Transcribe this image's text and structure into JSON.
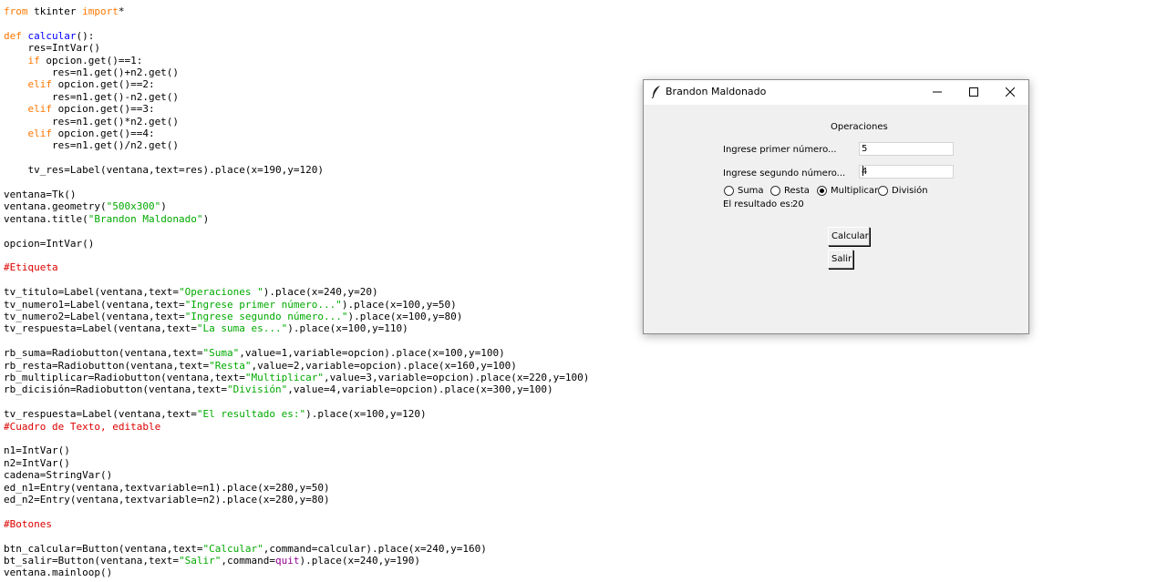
{
  "editor": {
    "lines": [
      [
        {
          "t": "from",
          "c": "kw"
        },
        {
          "t": " tkinter "
        },
        {
          "t": "import",
          "c": "kw"
        },
        {
          "t": "*"
        }
      ],
      [],
      [
        {
          "t": "def",
          "c": "kw"
        },
        {
          "t": " "
        },
        {
          "t": "calcular",
          "c": "def"
        },
        {
          "t": "():"
        }
      ],
      [
        {
          "t": "    res=IntVar()"
        }
      ],
      [
        {
          "t": "    "
        },
        {
          "t": "if",
          "c": "kw"
        },
        {
          "t": " opcion.get()==1:"
        }
      ],
      [
        {
          "t": "        res=n1.get()+n2.get()"
        }
      ],
      [
        {
          "t": "    "
        },
        {
          "t": "elif",
          "c": "kw"
        },
        {
          "t": " opcion.get()==2:"
        }
      ],
      [
        {
          "t": "        res=n1.get()-n2.get()"
        }
      ],
      [
        {
          "t": "    "
        },
        {
          "t": "elif",
          "c": "kw"
        },
        {
          "t": " opcion.get()==3:"
        }
      ],
      [
        {
          "t": "        res=n1.get()*n2.get()"
        }
      ],
      [
        {
          "t": "    "
        },
        {
          "t": "elif",
          "c": "kw"
        },
        {
          "t": " opcion.get()==4:"
        }
      ],
      [
        {
          "t": "        res=n1.get()/n2.get()"
        }
      ],
      [],
      [
        {
          "t": "    tv_res=Label(ventana,text=res).place(x=190,y=120)"
        }
      ],
      [],
      [
        {
          "t": "ventana=Tk()"
        }
      ],
      [
        {
          "t": "ventana.geometry("
        },
        {
          "t": "\"500x300\"",
          "c": "str"
        },
        {
          "t": ")"
        }
      ],
      [
        {
          "t": "ventana.title("
        },
        {
          "t": "\"Brandon Maldonado\"",
          "c": "str"
        },
        {
          "t": ")"
        }
      ],
      [],
      [
        {
          "t": "opcion=IntVar()"
        }
      ],
      [],
      [
        {
          "t": "#Etiqueta",
          "c": "cmt"
        }
      ],
      [],
      [
        {
          "t": "tv_titulo=Label(ventana,text="
        },
        {
          "t": "\"Operaciones \"",
          "c": "str"
        },
        {
          "t": ").place(x=240,y=20)"
        }
      ],
      [
        {
          "t": "tv_numero1=Label(ventana,text="
        },
        {
          "t": "\"Ingrese primer número...\"",
          "c": "str"
        },
        {
          "t": ").place(x=100,y=50)"
        }
      ],
      [
        {
          "t": "tv_numero2=Label(ventana,text="
        },
        {
          "t": "\"Ingrese segundo número...\"",
          "c": "str"
        },
        {
          "t": ").place(x=100,y=80)"
        }
      ],
      [
        {
          "t": "tv_respuesta=Label(ventana,text="
        },
        {
          "t": "\"La suma es...\"",
          "c": "str"
        },
        {
          "t": ").place(x=100,y=110)"
        }
      ],
      [],
      [
        {
          "t": "rb_suma=Radiobutton(ventana,text="
        },
        {
          "t": "\"Suma\"",
          "c": "str"
        },
        {
          "t": ",value=1,variable=opcion).place(x=100,y=100)"
        }
      ],
      [
        {
          "t": "rb_resta=Radiobutton(ventana,text="
        },
        {
          "t": "\"Resta\"",
          "c": "str"
        },
        {
          "t": ",value=2,variable=opcion).place(x=160,y=100)"
        }
      ],
      [
        {
          "t": "rb_multiplicar=Radiobutton(ventana,text="
        },
        {
          "t": "\"Multiplicar\"",
          "c": "str"
        },
        {
          "t": ",value=3,variable=opcion).place(x=220,y=100)"
        }
      ],
      [
        {
          "t": "rb_dicisión=Radiobutton(ventana,text="
        },
        {
          "t": "\"División\"",
          "c": "str"
        },
        {
          "t": ",value=4,variable=opcion).place(x=300,y=100)"
        }
      ],
      [],
      [
        {
          "t": "tv_respuesta=Label(ventana,text="
        },
        {
          "t": "\"El resultado es:\"",
          "c": "str"
        },
        {
          "t": ").place(x=100,y=120)"
        }
      ],
      [
        {
          "t": "#Cuadro de Texto, editable",
          "c": "cmt"
        }
      ],
      [],
      [
        {
          "t": "n1=IntVar()"
        }
      ],
      [
        {
          "t": "n2=IntVar()"
        }
      ],
      [
        {
          "t": "cadena=StringVar()"
        }
      ],
      [
        {
          "t": "ed_n1=Entry(ventana,textvariable=n1).place(x=280,y=50)"
        }
      ],
      [
        {
          "t": "ed_n2=Entry(ventana,textvariable=n2).place(x=280,y=80)"
        }
      ],
      [],
      [
        {
          "t": "#Botones",
          "c": "cmt"
        }
      ],
      [],
      [
        {
          "t": "btn_calcular=Button(ventana,text="
        },
        {
          "t": "\"Calcular\"",
          "c": "str"
        },
        {
          "t": ",command=calcular).place(x=240,y=160)"
        }
      ],
      [
        {
          "t": "bt_salir=Button(ventana,text="
        },
        {
          "t": "\"Salir\"",
          "c": "str"
        },
        {
          "t": ",command="
        },
        {
          "t": "quit",
          "c": "bi"
        },
        {
          "t": ").place(x=240,y=190)"
        }
      ],
      [
        {
          "t": "ventana.mainloop()"
        }
      ]
    ]
  },
  "window": {
    "title": "Brandon Maldonado",
    "heading": "Operaciones",
    "label_num1": "Ingrese primer número...",
    "label_num2": "Ingrese segundo número...",
    "entry1_value": "5",
    "entry2_value": "4",
    "radios": [
      {
        "label": "Suma",
        "selected": false
      },
      {
        "label": "Resta",
        "selected": false
      },
      {
        "label": "Multiplicar",
        "selected": true
      },
      {
        "label": "División",
        "selected": false
      }
    ],
    "result_label": "El resultado es:",
    "result_value": "20",
    "btn_calcular": "Calcular",
    "btn_salir": "Salir"
  },
  "icons": {
    "app": "feather-icon",
    "minimize": "minimize-icon",
    "maximize": "maximize-icon",
    "close": "close-icon"
  },
  "colors": {
    "keyword": "#ff7700",
    "definition": "#0000ff",
    "string": "#00aa00",
    "comment": "#dd0000",
    "builtin": "#900090",
    "window_bg": "#f0f0f0"
  }
}
